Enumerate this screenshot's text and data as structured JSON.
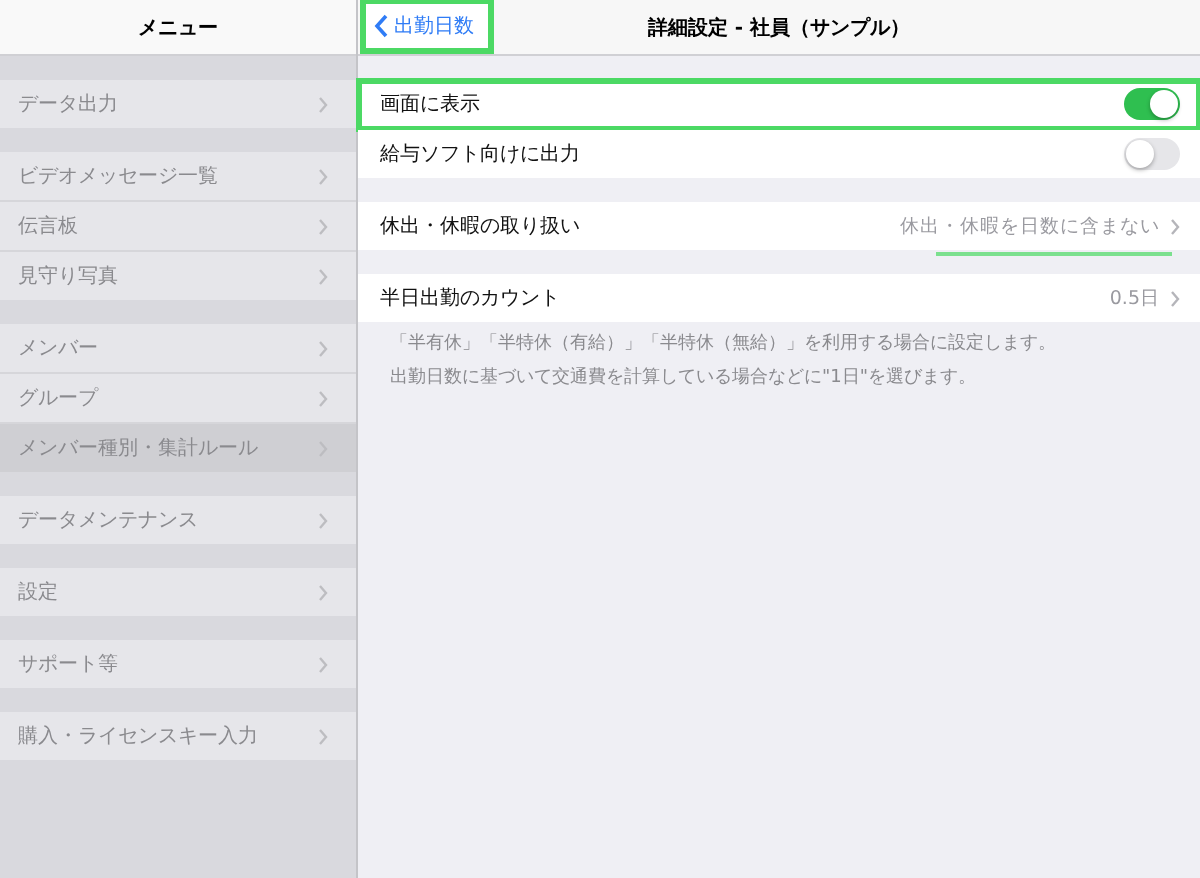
{
  "sidebar": {
    "title": "メニュー",
    "sections": [
      {
        "items": [
          {
            "label": "データ出力",
            "selected": false
          }
        ]
      },
      {
        "items": [
          {
            "label": "ビデオメッセージ一覧",
            "selected": false
          },
          {
            "label": "伝言板",
            "selected": false
          },
          {
            "label": "見守り写真",
            "selected": false
          }
        ]
      },
      {
        "items": [
          {
            "label": "メンバー",
            "selected": false
          },
          {
            "label": "グループ",
            "selected": false
          },
          {
            "label": "メンバー種別・集計ルール",
            "selected": true
          }
        ]
      },
      {
        "items": [
          {
            "label": "データメンテナンス",
            "selected": false
          }
        ]
      },
      {
        "items": [
          {
            "label": "設定",
            "selected": false
          }
        ]
      },
      {
        "items": [
          {
            "label": "サポート等",
            "selected": false
          }
        ]
      },
      {
        "items": [
          {
            "label": "購入・ライセンスキー入力",
            "selected": false
          }
        ]
      }
    ]
  },
  "detail": {
    "back_button": {
      "label": "出勤日数",
      "highlighted": true
    },
    "title": "詳細設定 - 社員（サンプル）",
    "sections": [
      {
        "rows": [
          {
            "kind": "toggle",
            "label": "画面に表示",
            "on": true,
            "highlighted": true
          },
          {
            "kind": "toggle",
            "label": "給与ソフト向けに出力",
            "on": false,
            "highlighted": false
          }
        ]
      },
      {
        "rows": [
          {
            "kind": "disclosure",
            "label": "休出・休暇の取り扱い",
            "value": "休出・休暇を日数に含まない",
            "underlined": true
          }
        ]
      },
      {
        "rows": [
          {
            "kind": "disclosure",
            "label": "半日出勤のカウント",
            "value": "0.5日",
            "underlined": false
          }
        ],
        "footer": [
          "「半有休」「半特休（有給）」「半特休（無給）」を利用する場合に設定します。",
          "出勤日数に基づいて交通費を計算している場合などに\"1日\"を選びます。"
        ]
      }
    ]
  }
}
